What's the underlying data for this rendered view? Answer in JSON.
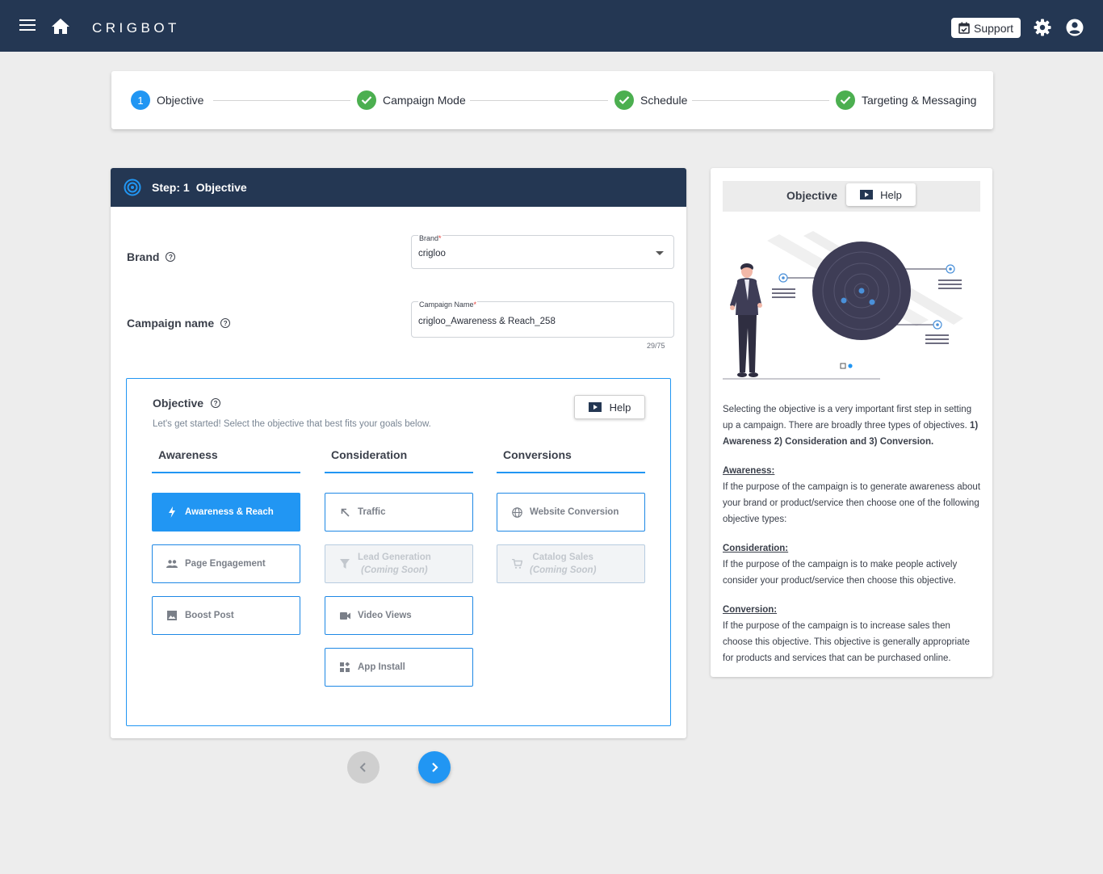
{
  "app": {
    "brand": "CRIGBOT",
    "support_label": "Support"
  },
  "stepper": [
    {
      "label": "Objective",
      "marker": "1",
      "state": "current"
    },
    {
      "label": "Campaign Mode",
      "state": "done"
    },
    {
      "label": "Schedule",
      "state": "done"
    },
    {
      "label": "Targeting & Messaging",
      "state": "done"
    }
  ],
  "card": {
    "step_label": "Step: 1",
    "step_title": "Objective",
    "brand_row_label": "Brand",
    "brand_field": {
      "label": "Brand",
      "required": "*",
      "value": "crigloo"
    },
    "campaign_row_label": "Campaign name",
    "campaign_field": {
      "label": "Campaign Name",
      "required": "*",
      "value": "crigloo_Awareness & Reach_258",
      "counter": "29/75"
    }
  },
  "objective": {
    "title": "Objective",
    "subtitle": "Let's get started! Select the objective that best fits your goals below.",
    "help_label": "Help",
    "columns": [
      {
        "heading": "Awareness"
      },
      {
        "heading": "Consideration"
      },
      {
        "heading": "Conversions"
      }
    ],
    "options": {
      "awareness_reach": "Awareness & Reach",
      "page_engagement": "Page Engagement",
      "boost_post": "Boost Post",
      "traffic": "Traffic",
      "lead_generation": "Lead Generation",
      "lead_generation_note": "(Coming Soon)",
      "video_views": "Video Views",
      "app_install": "App Install",
      "website_conversion": "Website Conversion",
      "catalog_sales": "Catalog Sales",
      "catalog_sales_note": "(Coming Soon)"
    },
    "selected": "Awareness & Reach"
  },
  "side": {
    "title": "Objective",
    "help_label": "Help",
    "intro": "Selecting the objective is a very important first step in setting up a campaign. There are broadly three types of objectives.",
    "intro_bold": "1) Awareness 2) Consideration and 3) Conversion.",
    "awareness_heading": "Awareness:",
    "awareness_text": "If the purpose of the campaign is to generate awareness about your brand or product/service then choose one of the following objective types:",
    "consideration_heading": "Consideration:",
    "consideration_text": "If the purpose of the campaign is to make people actively consider your product/service then choose this objective.",
    "conversion_heading": "Conversion:",
    "conversion_text": "If the purpose of the campaign is to increase sales then choose this objective. This objective is generally appropriate for products and services that can be purchased online."
  },
  "colors": {
    "topbar": "#243753",
    "accent": "#2196f3",
    "done": "#4caf50",
    "background": "#ededed"
  }
}
